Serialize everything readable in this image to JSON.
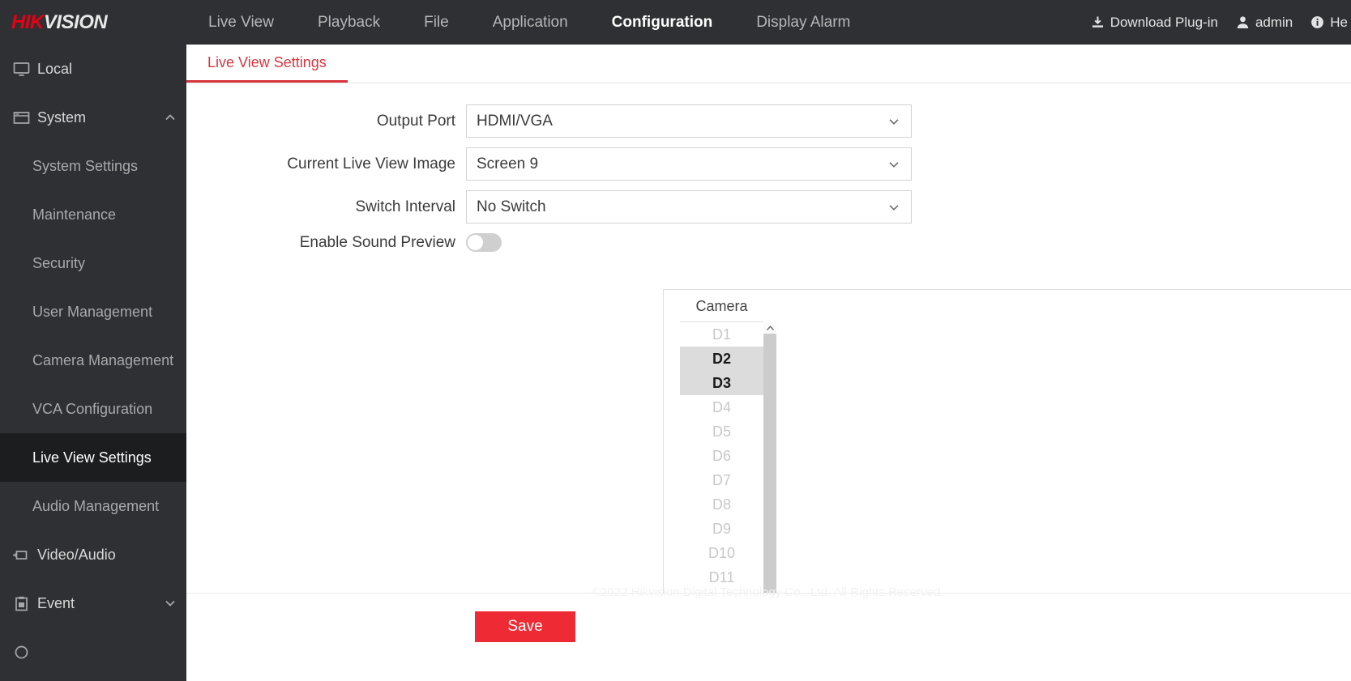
{
  "brand": {
    "name_part1": "HIK",
    "name_part2": "VISION"
  },
  "header": {
    "nav": [
      {
        "label": "Live View",
        "active": false
      },
      {
        "label": "Playback",
        "active": false
      },
      {
        "label": "File",
        "active": false
      },
      {
        "label": "Application",
        "active": false
      },
      {
        "label": "Configuration",
        "active": true
      },
      {
        "label": "Display Alarm",
        "active": false
      }
    ],
    "right": [
      {
        "label": "Download Plug-in",
        "icon": "download-icon"
      },
      {
        "label": "admin",
        "icon": "user-icon"
      },
      {
        "label": "He",
        "icon": "info-icon"
      }
    ]
  },
  "sidebar": {
    "items": [
      {
        "label": "Local",
        "icon": "monitor-icon",
        "type": "group",
        "expanded": false,
        "chevron": ""
      },
      {
        "label": "System",
        "icon": "window-icon",
        "type": "group",
        "expanded": true,
        "chevron": "up"
      },
      {
        "label": "System Settings",
        "type": "sub",
        "active": false
      },
      {
        "label": "Maintenance",
        "type": "sub",
        "active": false
      },
      {
        "label": "Security",
        "type": "sub",
        "active": false
      },
      {
        "label": "User Management",
        "type": "sub",
        "active": false
      },
      {
        "label": "Camera Management",
        "type": "sub",
        "active": false
      },
      {
        "label": "VCA Configuration",
        "type": "sub",
        "active": false
      },
      {
        "label": "Live View Settings",
        "type": "sub",
        "active": true
      },
      {
        "label": "Audio Management",
        "type": "sub",
        "active": false
      },
      {
        "label": "Video/Audio",
        "icon": "video-icon",
        "type": "group",
        "expanded": false,
        "chevron": ""
      },
      {
        "label": "Event",
        "icon": "clipboard-icon",
        "type": "group",
        "expanded": false,
        "chevron": "down"
      }
    ]
  },
  "main": {
    "tab": {
      "label": "Live View Settings",
      "active": true
    },
    "fields": [
      {
        "label": "Output Port",
        "value": "HDMI/VGA",
        "type": "select"
      },
      {
        "label": "Current Live View Image",
        "value": "Screen 9",
        "type": "select"
      },
      {
        "label": "Switch Interval",
        "value": "No Switch",
        "type": "select"
      }
    ],
    "toggle_field": {
      "label": "Enable Sound Preview",
      "state": "off"
    },
    "camera_panel": {
      "column_header": "Camera",
      "cameras": [
        {
          "id": "D1",
          "selected": false
        },
        {
          "id": "D2",
          "selected": true
        },
        {
          "id": "D3",
          "selected": true
        },
        {
          "id": "D4",
          "selected": false
        },
        {
          "id": "D5",
          "selected": false
        },
        {
          "id": "D6",
          "selected": false
        },
        {
          "id": "D7",
          "selected": false
        },
        {
          "id": "D8",
          "selected": false
        },
        {
          "id": "D9",
          "selected": false
        },
        {
          "id": "D10",
          "selected": false
        },
        {
          "id": "D11",
          "selected": false
        }
      ]
    }
  },
  "footer": {
    "save_label": "Save",
    "copyright": "©2022 Hikvision Digital Technology Co., Ltd. All Rights Reserved."
  },
  "colors": {
    "accent": "#ee2b35",
    "header_bg": "#2e3033",
    "sidebar_bg": "#2e3033",
    "sidebar_active_bg": "#1c1d1f",
    "tab_red": "#d9353d",
    "selected_row_bg": "#dcdcdc"
  }
}
